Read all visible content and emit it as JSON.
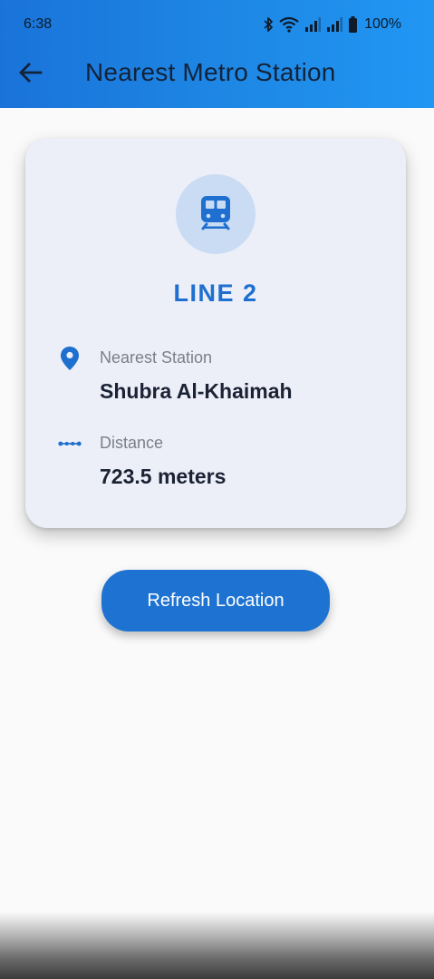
{
  "status_bar": {
    "time": "6:38",
    "battery_percent": "100%",
    "icons": [
      "bluetooth-icon",
      "wifi-icon",
      "signal-icon",
      "signal-icon",
      "battery-icon"
    ]
  },
  "app_bar": {
    "title": "Nearest Metro Station",
    "back_icon": "arrow-left-icon",
    "colors": {
      "gradient_start": "#1a73d9",
      "gradient_end": "#2196f3"
    }
  },
  "card": {
    "icon": "train-icon",
    "line_label": "LINE 2",
    "station": {
      "icon": "location-pin-icon",
      "label": "Nearest Station",
      "value": "Shubra Al-Khaimah"
    },
    "distance": {
      "icon": "route-dots-icon",
      "label": "Distance",
      "value": "723.5 meters"
    },
    "colors": {
      "accent": "#1e6fd0",
      "background": "#eceff8"
    }
  },
  "actions": {
    "refresh_label": "Refresh Location"
  }
}
